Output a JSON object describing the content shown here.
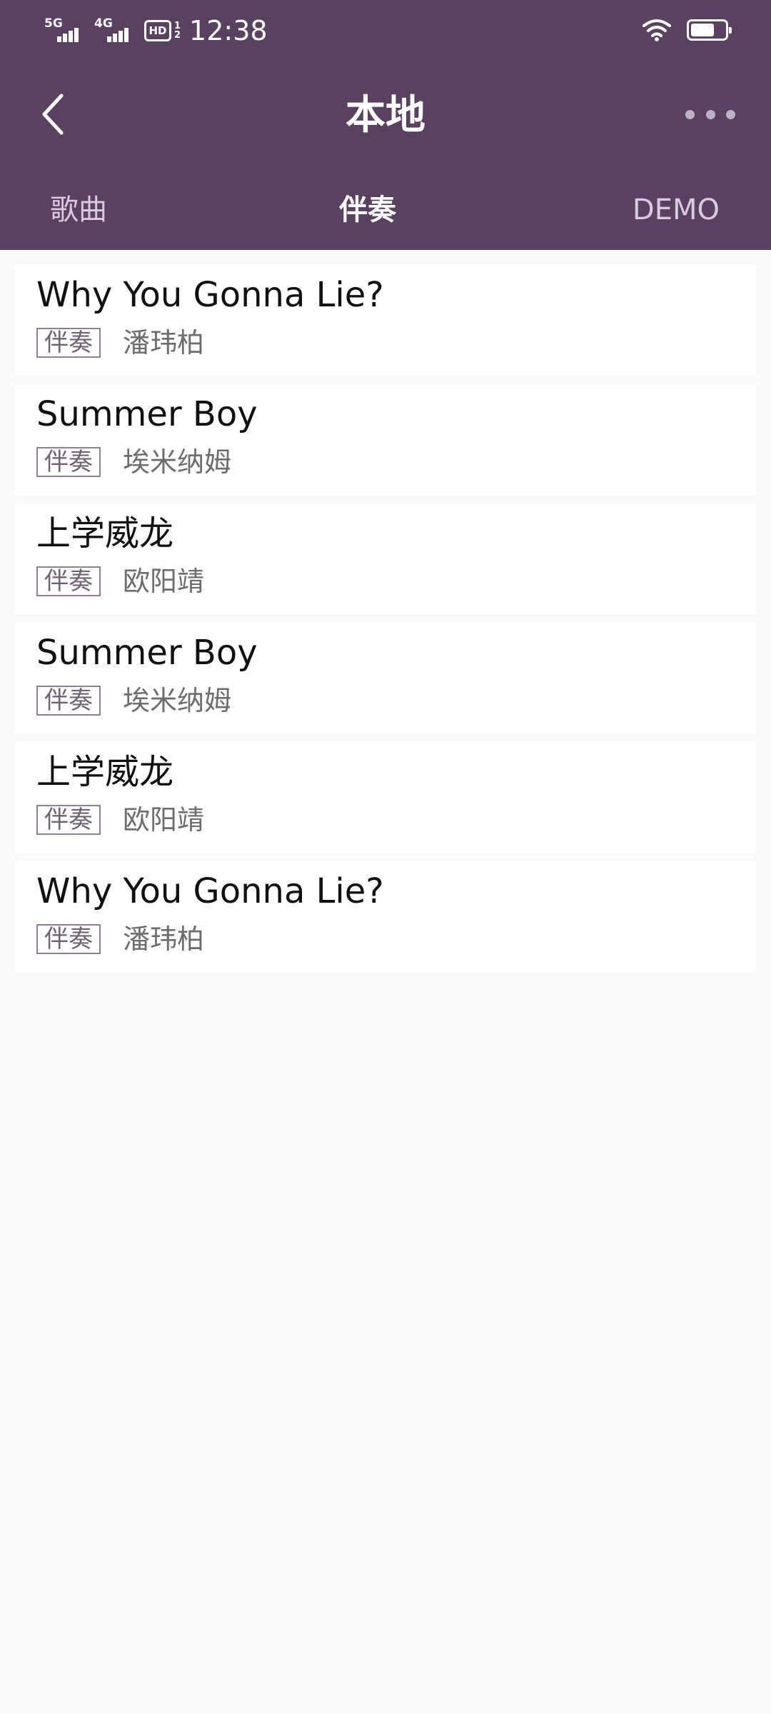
{
  "status_bar": {
    "network1": "5G",
    "network2": "4G",
    "hd_label": "HD",
    "hd_sub_top": "1",
    "hd_sub_bottom": "2",
    "time": "12:38"
  },
  "header": {
    "title": "本地"
  },
  "tabs": [
    {
      "label": "歌曲",
      "active": false
    },
    {
      "label": "伴奏",
      "active": true
    },
    {
      "label": "DEMO",
      "active": false
    }
  ],
  "songs": [
    {
      "title": "Why You Gonna Lie?",
      "tag": "伴奏",
      "artist": "潘玮柏"
    },
    {
      "title": "Summer Boy",
      "tag": "伴奏",
      "artist": "埃米纳姆"
    },
    {
      "title": "上学威龙",
      "tag": "伴奏",
      "artist": "欧阳靖"
    },
    {
      "title": "Summer Boy",
      "tag": "伴奏",
      "artist": "埃米纳姆"
    },
    {
      "title": "上学威龙",
      "tag": "伴奏",
      "artist": "欧阳靖"
    },
    {
      "title": "Why You Gonna Lie?",
      "tag": "伴奏",
      "artist": "潘玮柏"
    }
  ],
  "colors": {
    "header_bg": "#5a4061",
    "page_bg": "#f9f9f9"
  },
  "icons": [
    "back-icon",
    "more-icon",
    "wifi-icon",
    "battery-icon",
    "signal-icon"
  ]
}
